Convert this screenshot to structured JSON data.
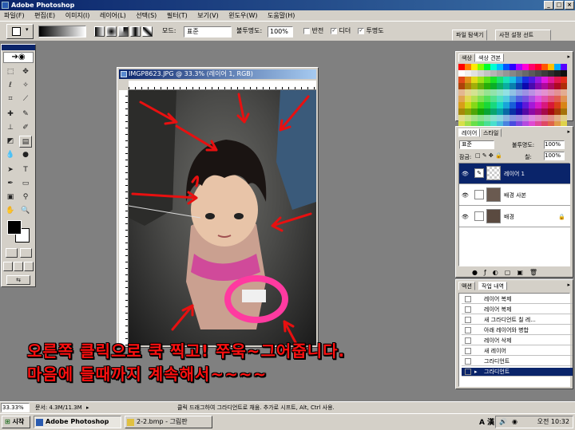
{
  "window": {
    "title": "Adobe Photoshop",
    "buttons": [
      "_",
      "□",
      "×"
    ]
  },
  "menu": [
    "파일(F)",
    "편집(E)",
    "이미지(I)",
    "레이어(L)",
    "선택(S)",
    "필터(T)",
    "보기(V)",
    "윈도우(W)",
    "도움말(H)"
  ],
  "options": {
    "mode_label": "모드:",
    "mode_value": "표준",
    "opacity_label": "불투명도:",
    "opacity_value": "100%",
    "reverse_label": "반전",
    "dither_label": "디더",
    "transparency_label": "투명도",
    "tab_file_browser": "파일 탐색기",
    "tab_presets": "사전 설정 선트"
  },
  "document": {
    "title": "IMGP8623.JPG @ 33.3% (레이어 1, RGB)"
  },
  "swatches_panel": {
    "tab1": "색상",
    "tab2": "색상 견본"
  },
  "layers_panel": {
    "tab1": "레이어",
    "tab2": "스타일",
    "blend_mode": "표준",
    "opacity_label": "불투명도:",
    "opacity_value": "100%",
    "lock_label": "잠금:",
    "fill_label": "칠:",
    "fill_value": "100%",
    "layers": [
      "레이어 1",
      "배경 사본",
      "배경"
    ]
  },
  "history_panel": {
    "tab1": "액션",
    "tab2": "작업 내역",
    "items": [
      "레이어 복제",
      "레이어 복제",
      "새 그라디언트 칠 레...",
      "아래 레이어와 병합",
      "레이어 삭제",
      "새 레이어",
      "그라디언트",
      "그라디언트"
    ]
  },
  "status": {
    "zoom": "33.33%",
    "doc_size": "문서: 4.3M/11.3M",
    "hint": "클릭 드래그하여 그라디언트로 채움. 추가로 시프트, Alt, Ctrl 사용."
  },
  "taskbar": {
    "start": "시작",
    "task1": "Adobe Photoshop",
    "task2": "2-2.bmp - 그림판",
    "ime": "A 漢",
    "clock": "오전 10:32"
  },
  "caption": {
    "line1": "오른쪽 클릭으로 쿡 찍고! 쭈욱~그어줍니다.",
    "line2": "마음에 들때까지 계속해서~~~~"
  },
  "colors": {
    "titlebar": "#0a246a",
    "caption": "#ff1010",
    "arrow": "#e81010"
  }
}
